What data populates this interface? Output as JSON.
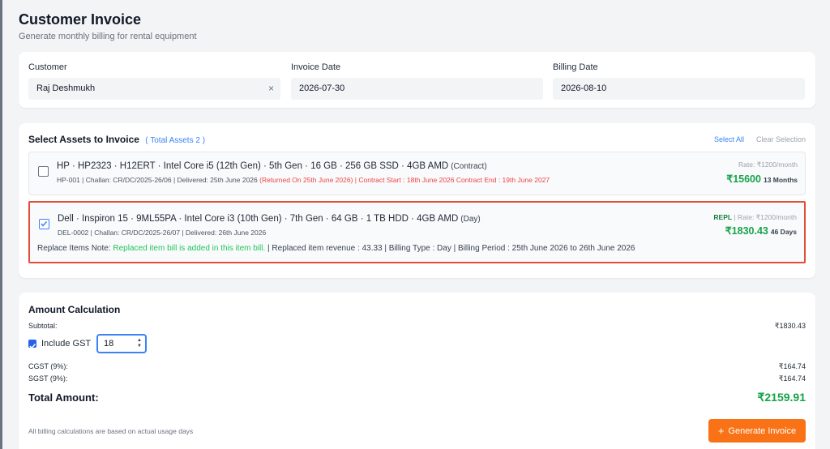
{
  "header": {
    "title": "Customer Invoice",
    "subtitle": "Generate monthly billing for rental equipment"
  },
  "fields": {
    "customer_label": "Customer",
    "customer_value": "Raj Deshmukh",
    "clear_icon": "×",
    "invoice_date_label": "Invoice Date",
    "invoice_date_value": "2026-07-30",
    "billing_date_label": "Billing Date",
    "billing_date_value": "2026-08-10"
  },
  "assets": {
    "title": "Select Assets to Invoice",
    "total_label": "( Total Assets 2 )",
    "select_all": "Select All",
    "clear_selection": "Clear Selection",
    "items": [
      {
        "checked": false,
        "title": "HP · HP2323 · H12ERT · Intel Core i5 (12th Gen) · 5th Gen · 16 GB · 256 GB SSD · 4GB AMD",
        "type": "(Contract)",
        "meta": "HP-001 |  Challan: CR/DC/2025-26/06 | Delivered: 25th June 2026 ",
        "meta_returned": "(Returned On 25th June 2026)",
        "meta_contract": " | Contract Start : 18th June 2026 Contract End : 19th June 2027",
        "rate": "Rate: ₹1200/month",
        "amount": "₹15600",
        "duration": "13 Months"
      },
      {
        "checked": true,
        "title": "Dell · Inspiron 15 · 9ML55PA · Intel Core i3 (10th Gen) · 7th Gen · 64 GB · 1 TB HDD · 4GB AMD",
        "type": "(Day)",
        "meta": "DEL-0002 |  Challan: CR/DC/2025-26/07 | Delivered: 26th June 2026",
        "repl": "REPL",
        "rate": " | Rate: ₹1200/month",
        "amount": "₹1830.43",
        "duration": "46 Days",
        "note_label": "Replace Items Note: ",
        "note_text": "Replaced item bill is added in this item bill.",
        "note_rest": "  | Replaced item revenue : 43.33 |  Billing Type : Day | Billing Period : 25th June 2026 to 26th June 2026"
      }
    ]
  },
  "amount": {
    "title": "Amount Calculation",
    "subtotal_label": "Subtotal:",
    "subtotal_value": "₹1830.43",
    "gst_checked": true,
    "gst_label": "Include GST",
    "gst_value": "18",
    "cgst_label": "CGST (9%):",
    "cgst_value": "₹164.74",
    "sgst_label": "SGST (9%):",
    "sgst_value": "₹164.74",
    "total_label": "Total Amount:",
    "total_value": "₹2159.91",
    "footnote": "All billing calculations are based on actual usage days",
    "generate_icon": "+",
    "generate_label": "Generate Invoice"
  },
  "colors": {
    "accent": "#3b82f6",
    "money_green": "#16a34a",
    "highlight_border": "#e24c38",
    "button_orange": "#f97316"
  }
}
